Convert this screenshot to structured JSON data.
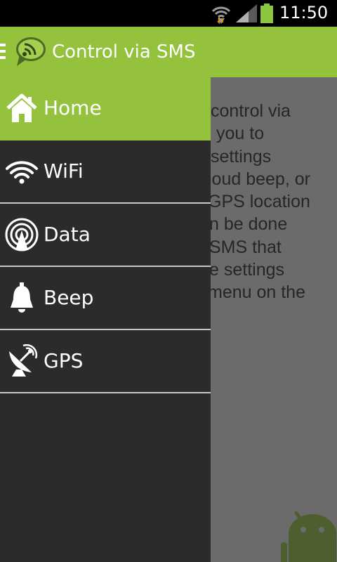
{
  "status_bar": {
    "time": "11:50",
    "icons": [
      "wifi-icon",
      "signal-icon",
      "battery-icon"
    ],
    "battery_color": "#8cc63f"
  },
  "action_bar": {
    "title": "Control via SMS",
    "background": "#95c23d"
  },
  "content": {
    "intro_text": "control via you to settings loud beep, or GPS location n be done SMS that e settings menu on the"
  },
  "drawer": {
    "items": [
      {
        "label": "Home",
        "icon": "home-icon",
        "active": true
      },
      {
        "label": "WiFi",
        "icon": "wifi-icon",
        "active": false
      },
      {
        "label": "Data",
        "icon": "data-icon",
        "active": false
      },
      {
        "label": "Beep",
        "icon": "bell-icon",
        "active": false
      },
      {
        "label": "GPS",
        "icon": "satellite-icon",
        "active": false
      }
    ]
  }
}
